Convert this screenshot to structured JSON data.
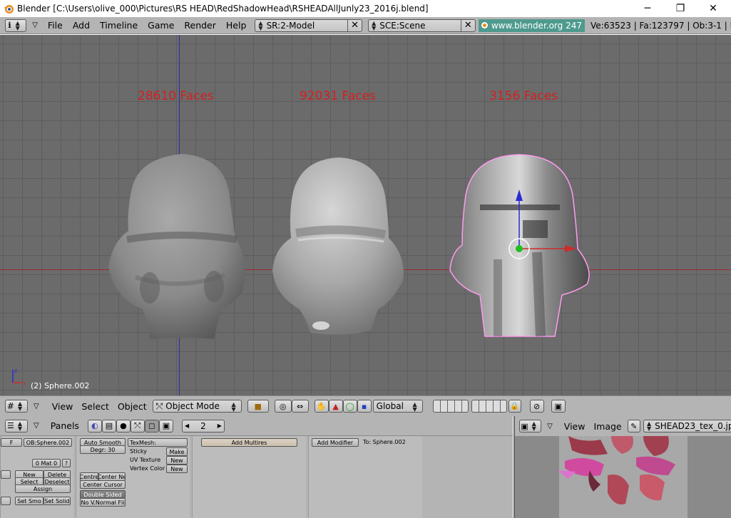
{
  "window": {
    "title": "Blender [C:\\Users\\olive_000\\Pictures\\RS HEAD\\RedShadowHead\\RSHEADAllJunly23_2016j.blend]",
    "minimize": "─",
    "maximize": "❐",
    "close": "✕"
  },
  "infobar": {
    "menus": [
      "File",
      "Add",
      "Timeline",
      "Game",
      "Render",
      "Help"
    ],
    "screen": "SR:2-Model",
    "scene": "SCE:Scene",
    "link": "www.blender.org 247",
    "stats": "Ve:63523 | Fa:123797 | Ob:3-1 | La"
  },
  "viewport": {
    "labels": [
      "28610 Faces",
      "92031 Faces",
      "3156 Faces"
    ],
    "object_name": "(2) Sphere.002",
    "axis_x": "x",
    "axis_z": "z"
  },
  "view3d_header": {
    "menus": [
      "View",
      "Select",
      "Object"
    ],
    "mode": "Object Mode",
    "orientation": "Global"
  },
  "buttons": {
    "panels_label": "Panels",
    "frame": "2",
    "link": {
      "ob_field": "OB:Sphere.002",
      "f_label": "F",
      "mat": "0 Mat 0",
      "mat_q": "?",
      "new": "New",
      "delete": "Delete",
      "select": "Select",
      "deselect": "Deselect",
      "assign": "Assign",
      "set_smooth": "Set Smo",
      "set_solid": "Set Solid"
    },
    "mesh": {
      "auto_smooth": "Auto Smooth",
      "degr": "Degr: 30",
      "centre": "Centre",
      "centre_new": "Center Ne",
      "centre_cursor": "Center Cursor",
      "double_sided": "Double Sided",
      "no_normal_flip": "No V.Normal Fli",
      "texmesh": "TexMesh:",
      "sticky": "Sticky",
      "make": "Make",
      "uv_texture": "UV Texture",
      "new1": "New",
      "vertex_color": "Vertex Color",
      "new2": "New"
    },
    "multires": {
      "add": "Add Multires"
    },
    "modifiers": {
      "add": "Add Modifier",
      "to": "To: Sphere.002"
    }
  },
  "image_editor": {
    "menus": [
      "View",
      "Image"
    ],
    "image_name": "SHEAD23_tex_0.jp"
  }
}
